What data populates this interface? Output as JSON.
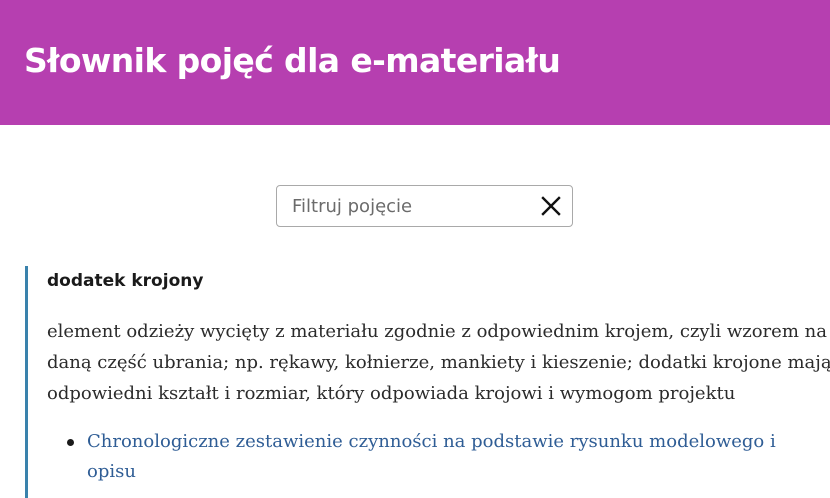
{
  "header": {
    "title": "Słownik pojęć dla e-materiału",
    "background_color": "#b63fb0"
  },
  "search": {
    "placeholder": "Filtruj pojęcie",
    "value": "",
    "clear_icon": "close-icon"
  },
  "entry": {
    "term": "dodatek krojony",
    "definition": "element odzieży wycięty z materiału zgodnie z odpowiednim krojem, czyli wzorem na daną część ubrania; np. rękawy, kołnierze, mankiety i kieszenie; dodatki krojone mają odpowiedni kształt i rozmiar, który odpowiada krojowi i wymogom projektu",
    "accent_color": "#3a82ac",
    "related": [
      {
        "label": "Chronologiczne zestawienie czynności na podstawie rysunku modelowego i opisu"
      }
    ],
    "link_color": "#2f5d95"
  }
}
